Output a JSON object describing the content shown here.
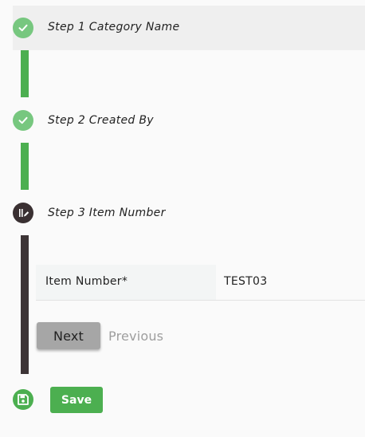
{
  "steps": [
    {
      "number": "1",
      "label": "Step 1 Category Name",
      "status": "completed",
      "icon": "check-icon"
    },
    {
      "number": "2",
      "label": "Step 2 Created By",
      "status": "completed",
      "icon": "check-icon"
    },
    {
      "number": "3",
      "label": "Step 3 Item Number",
      "status": "current",
      "icon": "edit-icon"
    }
  ],
  "current_step": {
    "field": {
      "label": "Item Number*",
      "value": "TEST03"
    },
    "next_label": "Next",
    "previous_label": "Previous"
  },
  "save": {
    "icon": "floppy-disk-icon",
    "label": "Save"
  },
  "colors": {
    "completed_circle": "#77c77f",
    "completed_connector": "#4caf50",
    "current_circle": "#3a3032",
    "current_connector": "#3d3436",
    "save_button": "#4caf50",
    "next_button": "#a6a6a6",
    "previous_text": "#9e9e9e"
  }
}
